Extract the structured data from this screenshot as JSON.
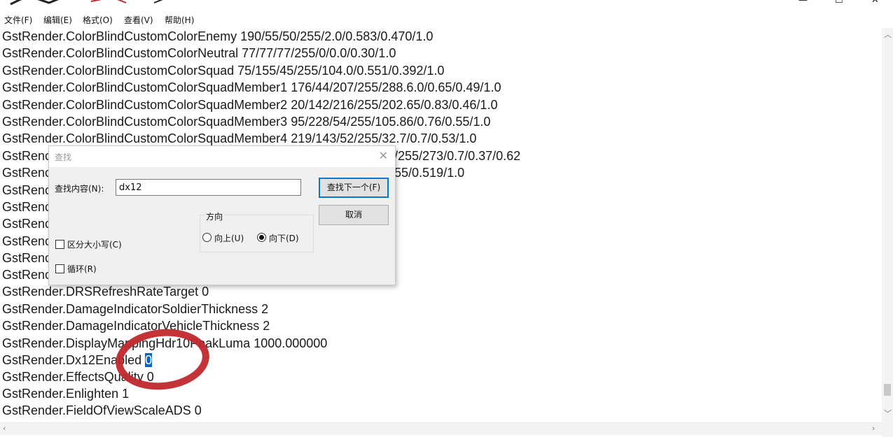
{
  "window": {
    "controls": {
      "minimize": "—",
      "maximize": "☐",
      "close": "✕"
    }
  },
  "menu": [
    {
      "label": "文件(F)"
    },
    {
      "label": "编辑(E)"
    },
    {
      "label": "格式(O)"
    },
    {
      "label": "查看(V)"
    },
    {
      "label": "帮助(H)"
    }
  ],
  "editor": {
    "lines": [
      "GstRender.ColorBlindCustomColorEnemy 190/55/50/255/2.0/0.583/0.470/1.0",
      "GstRender.ColorBlindCustomColorNeutral 77/77/77/255/0/0.0/0.30/1.0",
      "GstRender.ColorBlindCustomColorSquad 75/155/45/255/104.0/0.551/0.392/1.0",
      "GstRender.ColorBlindCustomColorSquadMember1 176/44/207/255/288.6.0/0.65/0.49/1.0",
      "GstRender.ColorBlindCustomColorSquadMember2 20/142/216/255/202.65/0.83/0.46/1.0",
      "GstRender.ColorBlindCustomColorSquadMember3 95/228/54/255/105.86/0.76/0.55/1.0",
      "GstRender.ColorBlindCustomColorSquadMember4 219/143/52/255/32.7/0.7/0.53/1.0",
      "GstRenc",
      "GstRenc",
      "GstRenc",
      "GstRenc",
      "GstRenc",
      "GstRenc",
      "GstRenc",
      "GstRenc",
      "GstRender.DRSRefreshRateTarget 0",
      "GstRender.DamageIndicatorSoldierThickness 2",
      "GstRender.DamageIndicatorVehicleThickness 2",
      "GstRender.DisplayMappingHdr10PeakLuma 1000.000000",
      "GstRender.Dx12Enabled ",
      "GstRender.EffectsQuality 0",
      "GstRender.Enlighten 1",
      "GstRender.FieldOfViewScaleADS 0"
    ],
    "line8_tail": "/255/273/0.7/0.37/0.62",
    "line9_tail": "55/0.519/1.0",
    "selected_value": "0"
  },
  "find_dialog": {
    "title": "查找",
    "find_label": "查找内容(N):",
    "find_value": "dx12",
    "find_next": "查找下一个(F)",
    "cancel": "取消",
    "direction_label": "方向",
    "up_label": "向上(U)",
    "down_label": "向下(D)",
    "direction_selected": "down",
    "match_case_label": "区分大小写(C)",
    "match_case_checked": false,
    "wrap_label": "循环(R)",
    "wrap_checked": false
  },
  "annotation": {
    "color": "#c0282d"
  }
}
